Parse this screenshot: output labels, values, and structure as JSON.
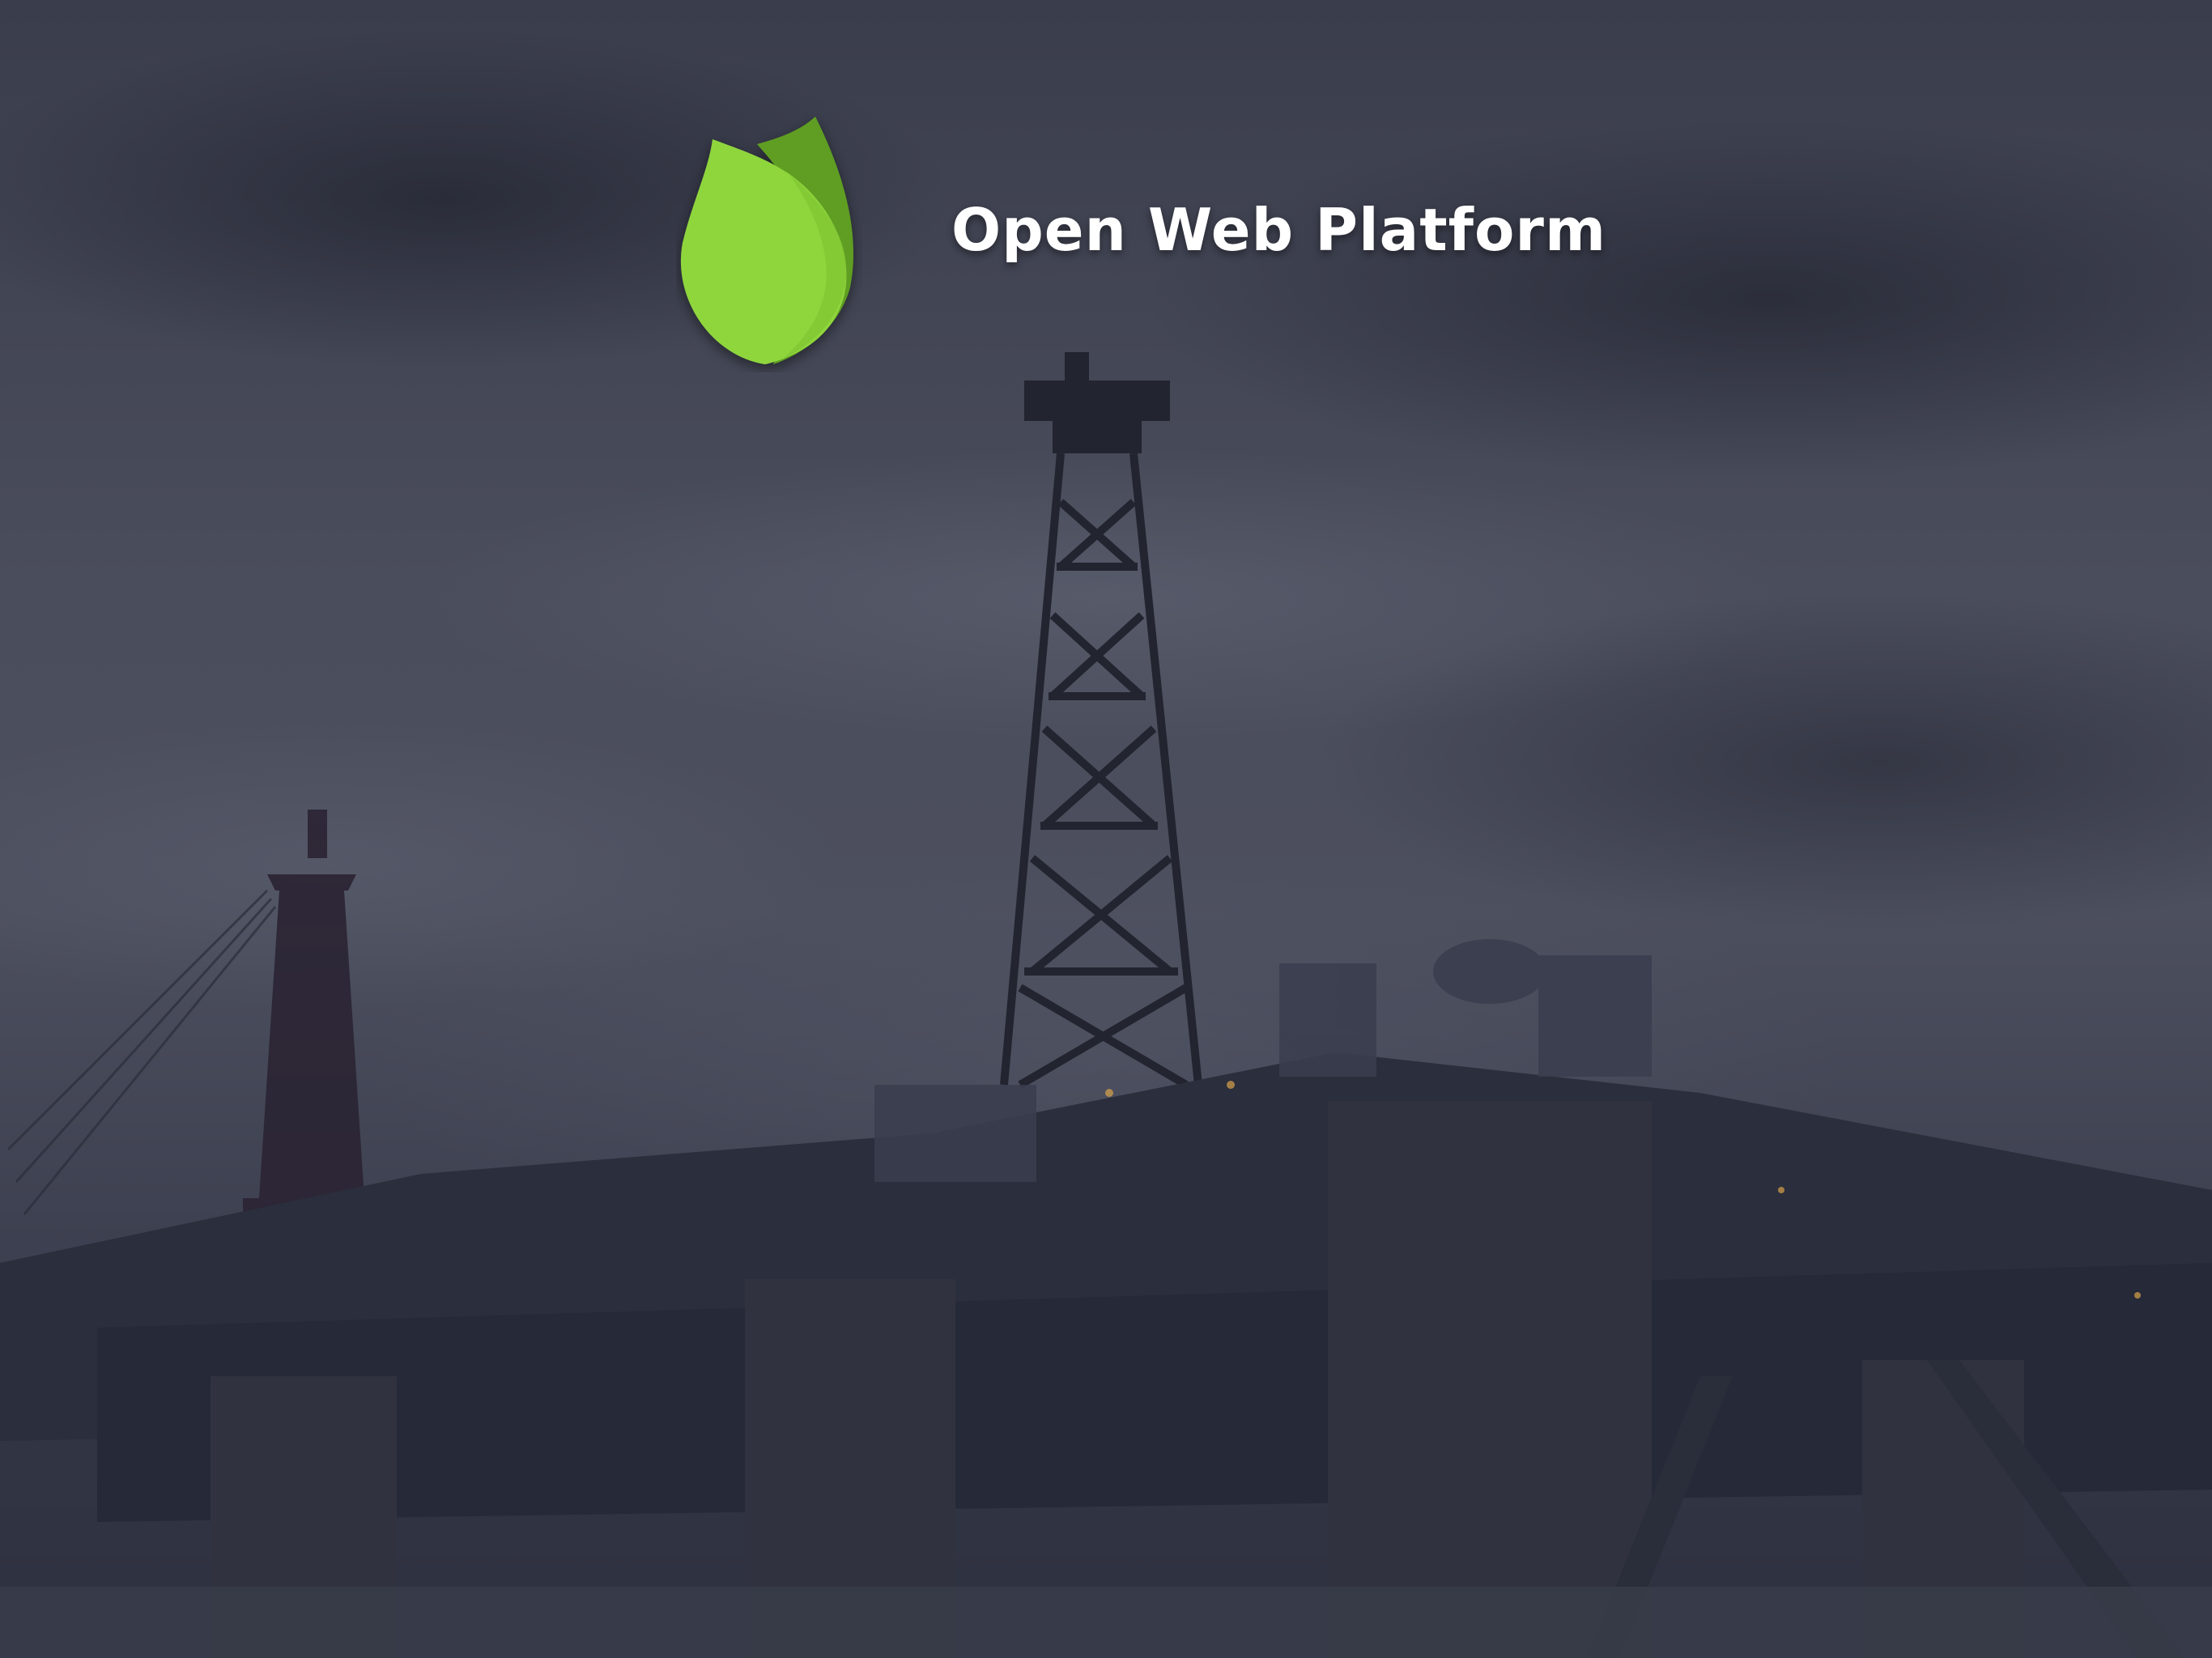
{
  "slide": {
    "title": "Open Web Platform",
    "logo_icon": "green-leaf-icon",
    "background": "dark-stormy-sky-oil-rig-photo",
    "colors": {
      "leaf_light": "#8fd63c",
      "leaf_dark": "#5f9e22",
      "title_text": "#ffffff",
      "overlay": "#3c3f4e"
    }
  }
}
